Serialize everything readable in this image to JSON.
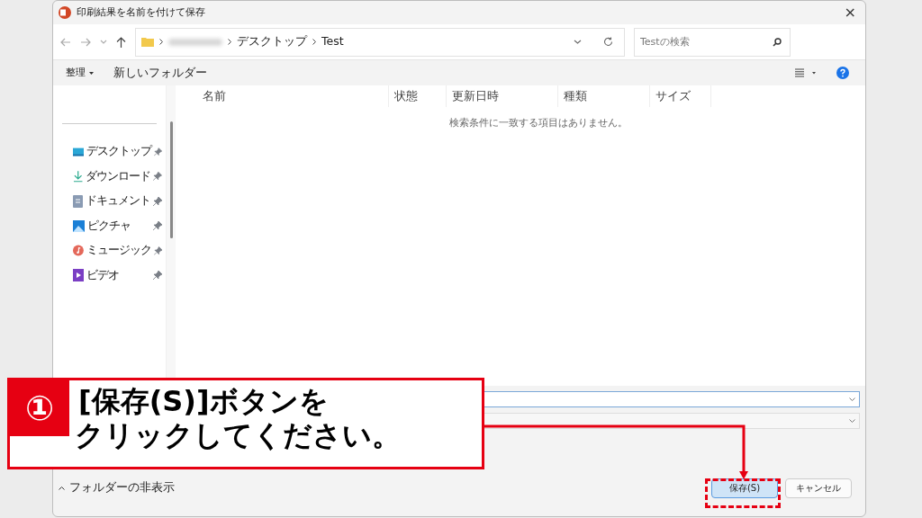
{
  "window": {
    "title": "印刷結果を名前を付けて保存",
    "close": "×"
  },
  "address_bar": {
    "segments": [
      "デスクトップ",
      "Test"
    ]
  },
  "search": {
    "placeholder": "Testの検索"
  },
  "toolbar": {
    "organize": "整理",
    "new_folder": "新しいフォルダー"
  },
  "sidebar": {
    "items": [
      {
        "label": "デスクトップ",
        "kind": "desktop"
      },
      {
        "label": "ダウンロード",
        "kind": "download"
      },
      {
        "label": "ドキュメント",
        "kind": "document"
      },
      {
        "label": "ピクチャ",
        "kind": "picture"
      },
      {
        "label": "ミュージック",
        "kind": "music"
      },
      {
        "label": "ビデオ",
        "kind": "video"
      }
    ]
  },
  "table": {
    "columns": [
      "名前",
      "状態",
      "更新日時",
      "種類",
      "サイズ"
    ],
    "empty_message": "検索条件に一致する項目はありません。"
  },
  "footer": {
    "hide_folders": "フォルダーの非表示",
    "save": "保存(S)",
    "cancel": "キャンセル"
  },
  "callout": {
    "number": "①",
    "lines": [
      "[保存(S)]ボタンを",
      "クリックしてください。"
    ]
  }
}
